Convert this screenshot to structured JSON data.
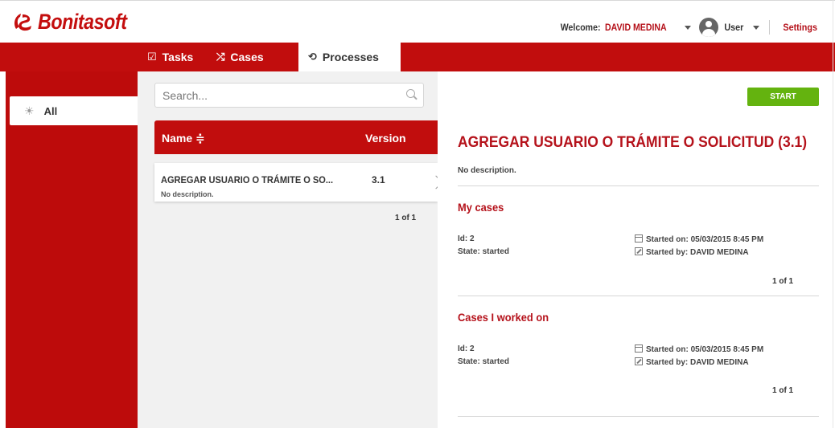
{
  "header": {
    "brand": "Bonitasoft",
    "welcome_label": "Welcome:",
    "user_name": "DAVID MEDINA",
    "profile": "User",
    "settings": "Settings"
  },
  "tabs": [
    {
      "label": "Tasks",
      "icon": "checkbox-icon"
    },
    {
      "label": "Cases",
      "icon": "shuffle-icon"
    },
    {
      "label": "Processes",
      "icon": "process-icon",
      "active": true
    }
  ],
  "sidebar": {
    "items": [
      {
        "label": "All",
        "icon": "sun-icon",
        "selected": true
      }
    ]
  },
  "search": {
    "placeholder": "Search..."
  },
  "process_table": {
    "columns": {
      "name": "Name ≑",
      "version": "Version"
    },
    "rows": [
      {
        "name": "AGREGAR USUARIO O TRÁMITE O SO...",
        "version": "3.1",
        "description": "No description."
      }
    ],
    "pager": "1 of 1"
  },
  "details": {
    "start_label": "START",
    "title": "AGREGAR USUARIO O TRÁMITE O SOLICITUD (3.1)",
    "description": "No description.",
    "my_cases": {
      "title": "My cases",
      "id_label": "Id:",
      "id": "2",
      "state_label": "State:",
      "state": "started",
      "started_on_label": "Started on:",
      "started_on": "05/03/2015 8:45 PM",
      "started_by_label": "Started by:",
      "started_by": "DAVID MEDINA",
      "pager": "1 of 1"
    },
    "worked_on": {
      "title": "Cases I worked on",
      "id_label": "Id:",
      "id": "2",
      "state_label": "State:",
      "state": "started",
      "started_on_label": "Started on:",
      "started_on": "05/03/2015 8:45 PM",
      "started_by_label": "Started by:",
      "started_by": "DAVID MEDINA",
      "pager": "1 of 1"
    }
  },
  "colors": {
    "brand_red": "#c10d0d",
    "title_red": "#b5121b",
    "start_green": "#64b30f"
  }
}
